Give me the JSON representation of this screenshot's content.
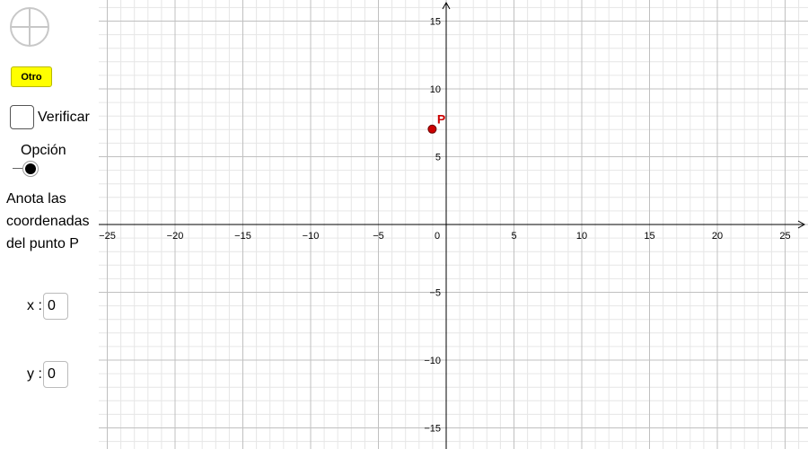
{
  "sidebar": {
    "reset_icon": "reset-circle-icon",
    "otro_label": "Otro",
    "verificar_label": "Verificar",
    "verificar_checked": false,
    "opcion_label": "Opción",
    "instructions": [
      "Anota las",
      "coordenadas",
      "del punto P"
    ],
    "x_label": "x :",
    "x_value": "0",
    "y_label": "y :",
    "y_value": "0"
  },
  "graph": {
    "x_ticks": [
      "−25",
      "−20",
      "−15",
      "−10",
      "−5",
      "0",
      "5",
      "10",
      "15",
      "20",
      "25"
    ],
    "y_ticks": [
      "15",
      "10",
      "5",
      "−5",
      "−10",
      "−15"
    ],
    "point": {
      "label": "P",
      "x": -1,
      "y": 7,
      "color": "#cc0000"
    },
    "grid_minor_color": "#e6e6e6",
    "grid_major_color": "#c0c0c0"
  }
}
